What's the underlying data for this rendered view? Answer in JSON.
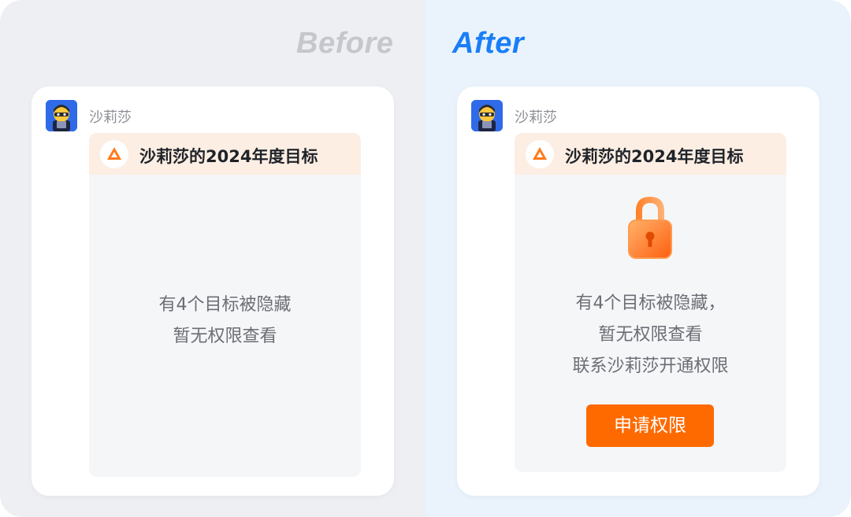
{
  "before": {
    "heading": "Before",
    "sender": "沙莉莎",
    "message_title": "沙莉莎的2024年度目标",
    "lines": [
      "有4个目标被隐藏",
      "暂无权限查看"
    ]
  },
  "after": {
    "heading": "After",
    "sender": "沙莉莎",
    "message_title": "沙莉莎的2024年度目标",
    "lines": [
      "有4个目标被隐藏，",
      "暂无权限查看",
      "联系沙莉莎开通权限"
    ],
    "button_label": "申请权限"
  },
  "colors": {
    "accent_blue": "#1a7ef7",
    "accent_orange": "#ff6a00",
    "header_tint": "#fdeee3"
  },
  "icons": {
    "avatar": "cartoon-avatar-icon",
    "goal": "goal-app-icon",
    "lock": "padlock-icon"
  }
}
